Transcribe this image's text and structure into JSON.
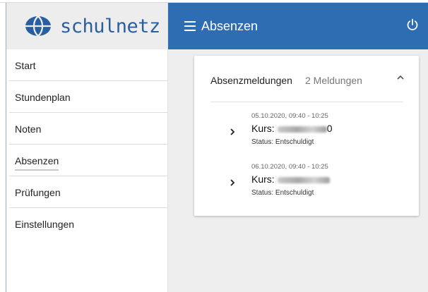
{
  "app": {
    "logo_text": "schulnetz",
    "brand_color": "#2f6db3"
  },
  "sidebar": {
    "items": [
      {
        "label": "Start"
      },
      {
        "label": "Stundenplan"
      },
      {
        "label": "Noten"
      },
      {
        "label": "Absenzen",
        "active": true
      },
      {
        "label": "Prüfungen"
      },
      {
        "label": "Einstellungen"
      }
    ]
  },
  "header": {
    "menu_icon": "hamburger-icon",
    "title": "Absenzen",
    "power_icon": "power-icon"
  },
  "card": {
    "title": "Absenzmeldungen",
    "count": "2 Meldungen",
    "collapse_icon": "chevron-up-icon",
    "entries": [
      {
        "datetime": "05.10.2020, 09:40 - 10:25",
        "kurs_label": "Kurs:",
        "kurs_visible_suffix": "0",
        "status": "Status: Entschuldigt"
      },
      {
        "datetime": "06.10.2020, 09:40 - 10:25",
        "kurs_label": "Kurs:",
        "kurs_visible_suffix": "",
        "status": "Status: Entschuldigt"
      }
    ]
  }
}
